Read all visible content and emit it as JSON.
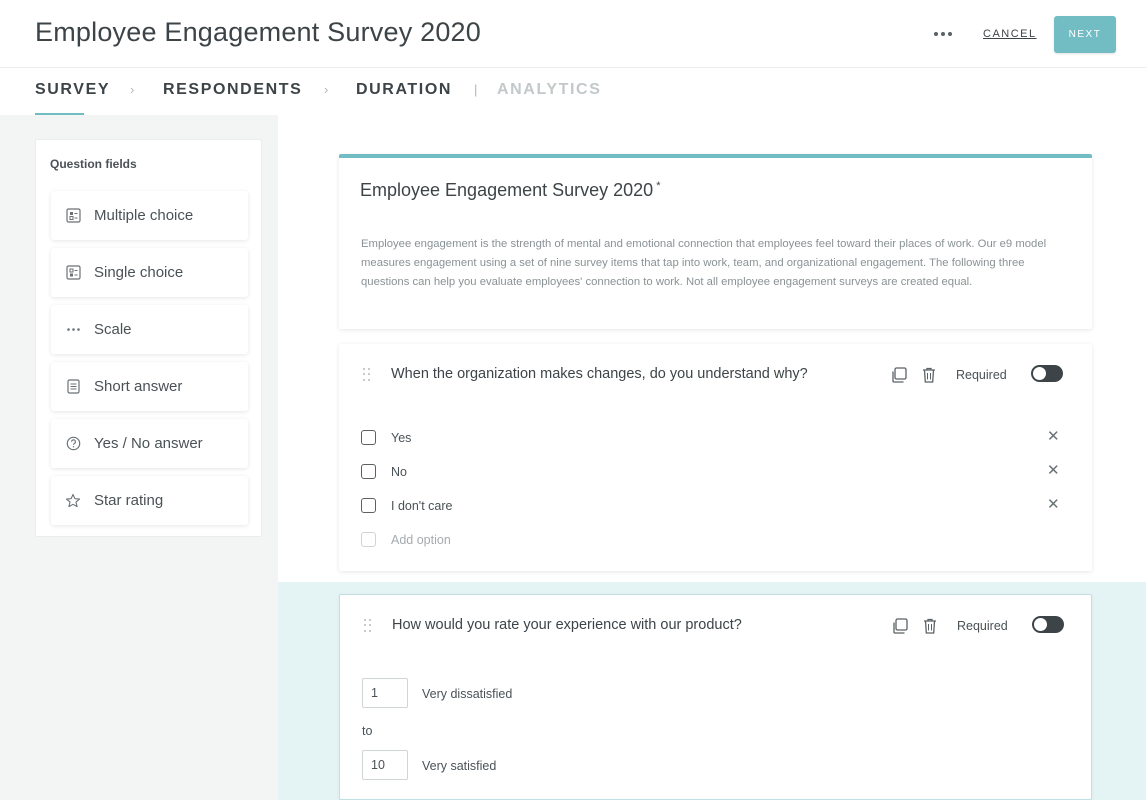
{
  "header": {
    "title": "Employee Engagement Survey 2020",
    "more_icon": "more-dots-icon",
    "cancel_label": "CANCEL",
    "next_label": "NEXT"
  },
  "tabs": [
    {
      "label": "SURVEY",
      "active": true
    },
    {
      "label": "RESPONDENTS",
      "active": false
    },
    {
      "label": "DURATION",
      "active": false
    },
    {
      "label": "ANALYTICS",
      "disabled": true
    }
  ],
  "tab_separators": [
    "›",
    "›",
    "|"
  ],
  "sidebar": {
    "title": "Question fields",
    "items": [
      {
        "label": "Multiple choice",
        "icon": "multiple-choice-icon"
      },
      {
        "label": "Single choice",
        "icon": "single-choice-icon"
      },
      {
        "label": "Scale",
        "icon": "scale-icon"
      },
      {
        "label": "Short answer",
        "icon": "short-answer-icon"
      },
      {
        "label": "Yes / No answer",
        "icon": "yes-no-icon"
      },
      {
        "label": "Star rating",
        "icon": "star-icon"
      }
    ]
  },
  "survey": {
    "title": "Employee Engagement Survey 2020",
    "required_marker": "*",
    "description": "Employee engagement is the strength of mental and emotional connection that employees feel toward their places of work. Our e9 model measures engagement using a set of nine survey items that tap into work, team, and organizational engagement. The following three questions can help you evaluate employees' connection to work. Not all employee engagement surveys are created equal."
  },
  "questions": [
    {
      "text": "When the organization makes changes, do you understand why?",
      "required_label": "Required",
      "options": [
        "Yes",
        "No",
        "I don't care"
      ],
      "add_option_label": "Add option"
    },
    {
      "text": "How would you rate your experience with our product?",
      "required_label": "Required",
      "scale_min": "1",
      "scale_min_label": "Very dissatisfied",
      "scale_to": "to",
      "scale_max": "10",
      "scale_max_label": "Very satisfied"
    }
  ],
  "colors": {
    "accent": "#71bdc3",
    "text": "#3d4448",
    "highlight": "#e4f3f4"
  }
}
